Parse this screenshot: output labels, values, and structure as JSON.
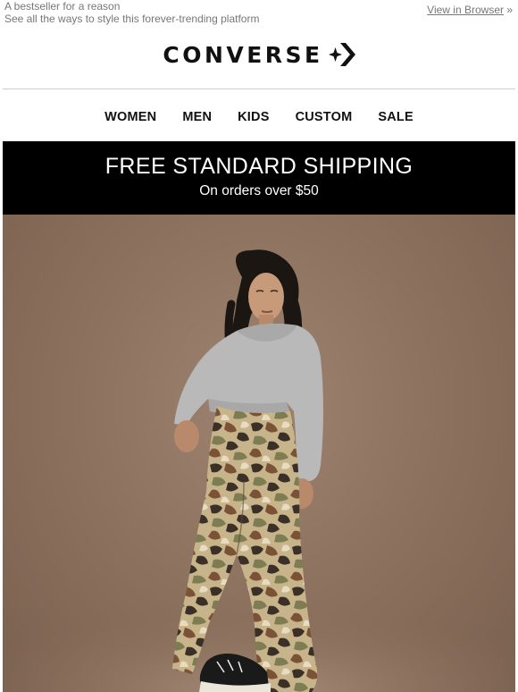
{
  "preheader": {
    "line1": "A bestseller for a reason",
    "line2": "See all the ways to style this forever-trending platform"
  },
  "view_browser": {
    "link": "View in Browser",
    "suffix": " »"
  },
  "logo": {
    "text": "CONVERSE",
    "mark_icon": "converse-star-chevron-icon"
  },
  "nav": {
    "items": [
      {
        "label": "WOMEN"
      },
      {
        "label": "MEN"
      },
      {
        "label": "KIDS"
      },
      {
        "label": "CUSTOM"
      },
      {
        "label": "SALE"
      }
    ]
  },
  "banner": {
    "title": "FREE STANDARD SHIPPING",
    "subtitle": "On orders over $50"
  },
  "hero": {
    "colors": {
      "background": "#8c715e",
      "sweater": "#b9b9b9",
      "camo_base": "#c8b48a",
      "camo_dark": "#3a3028",
      "camo_brown": "#7a5236",
      "camo_olive": "#7d7c52"
    }
  }
}
